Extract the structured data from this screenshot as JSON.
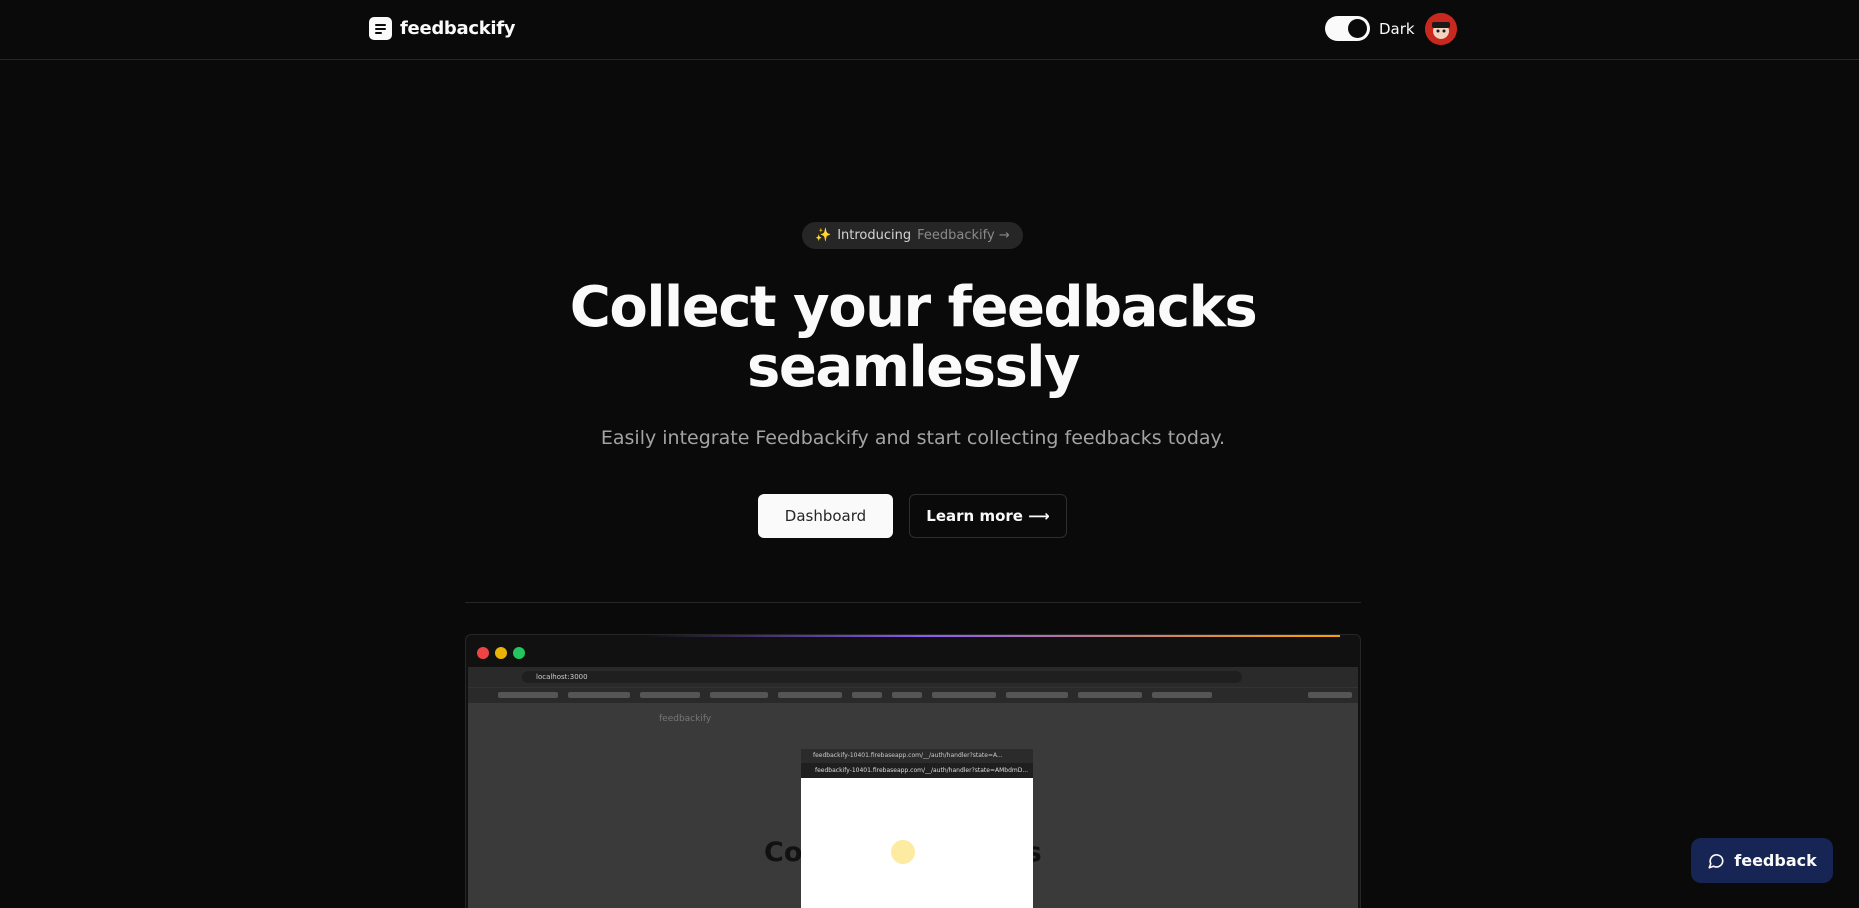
{
  "header": {
    "brand": "feedbackify",
    "theme_label": "Dark",
    "theme_on": true
  },
  "hero": {
    "badge_icon": "✨",
    "badge_text_a": "Introducing",
    "badge_text_b": "Feedbackify →",
    "title_line1": "Collect your feedbacks",
    "title_line2": "seamlessly",
    "subtitle": "Easily integrate Feedbackify and start collecting feedbacks today.",
    "primary_button": "Dashboard",
    "secondary_button": "Learn more ⟶"
  },
  "preview": {
    "url": "localhost:3000",
    "inner_brand": "feedbackify",
    "inner_heading_left": "Col",
    "inner_heading_right": "ks",
    "popup_title": "feedbackify-10401.firebaseapp.com/__/auth/handler?state=A...",
    "popup_url": "feedbackify-10401.firebaseapp.com/__/auth/handler?state=AMbdmD..."
  },
  "floating": {
    "feedback_label": "feedback"
  },
  "colors": {
    "background": "#0a0a0a",
    "accent_widget": "#172554",
    "avatar": "#c8281e"
  }
}
